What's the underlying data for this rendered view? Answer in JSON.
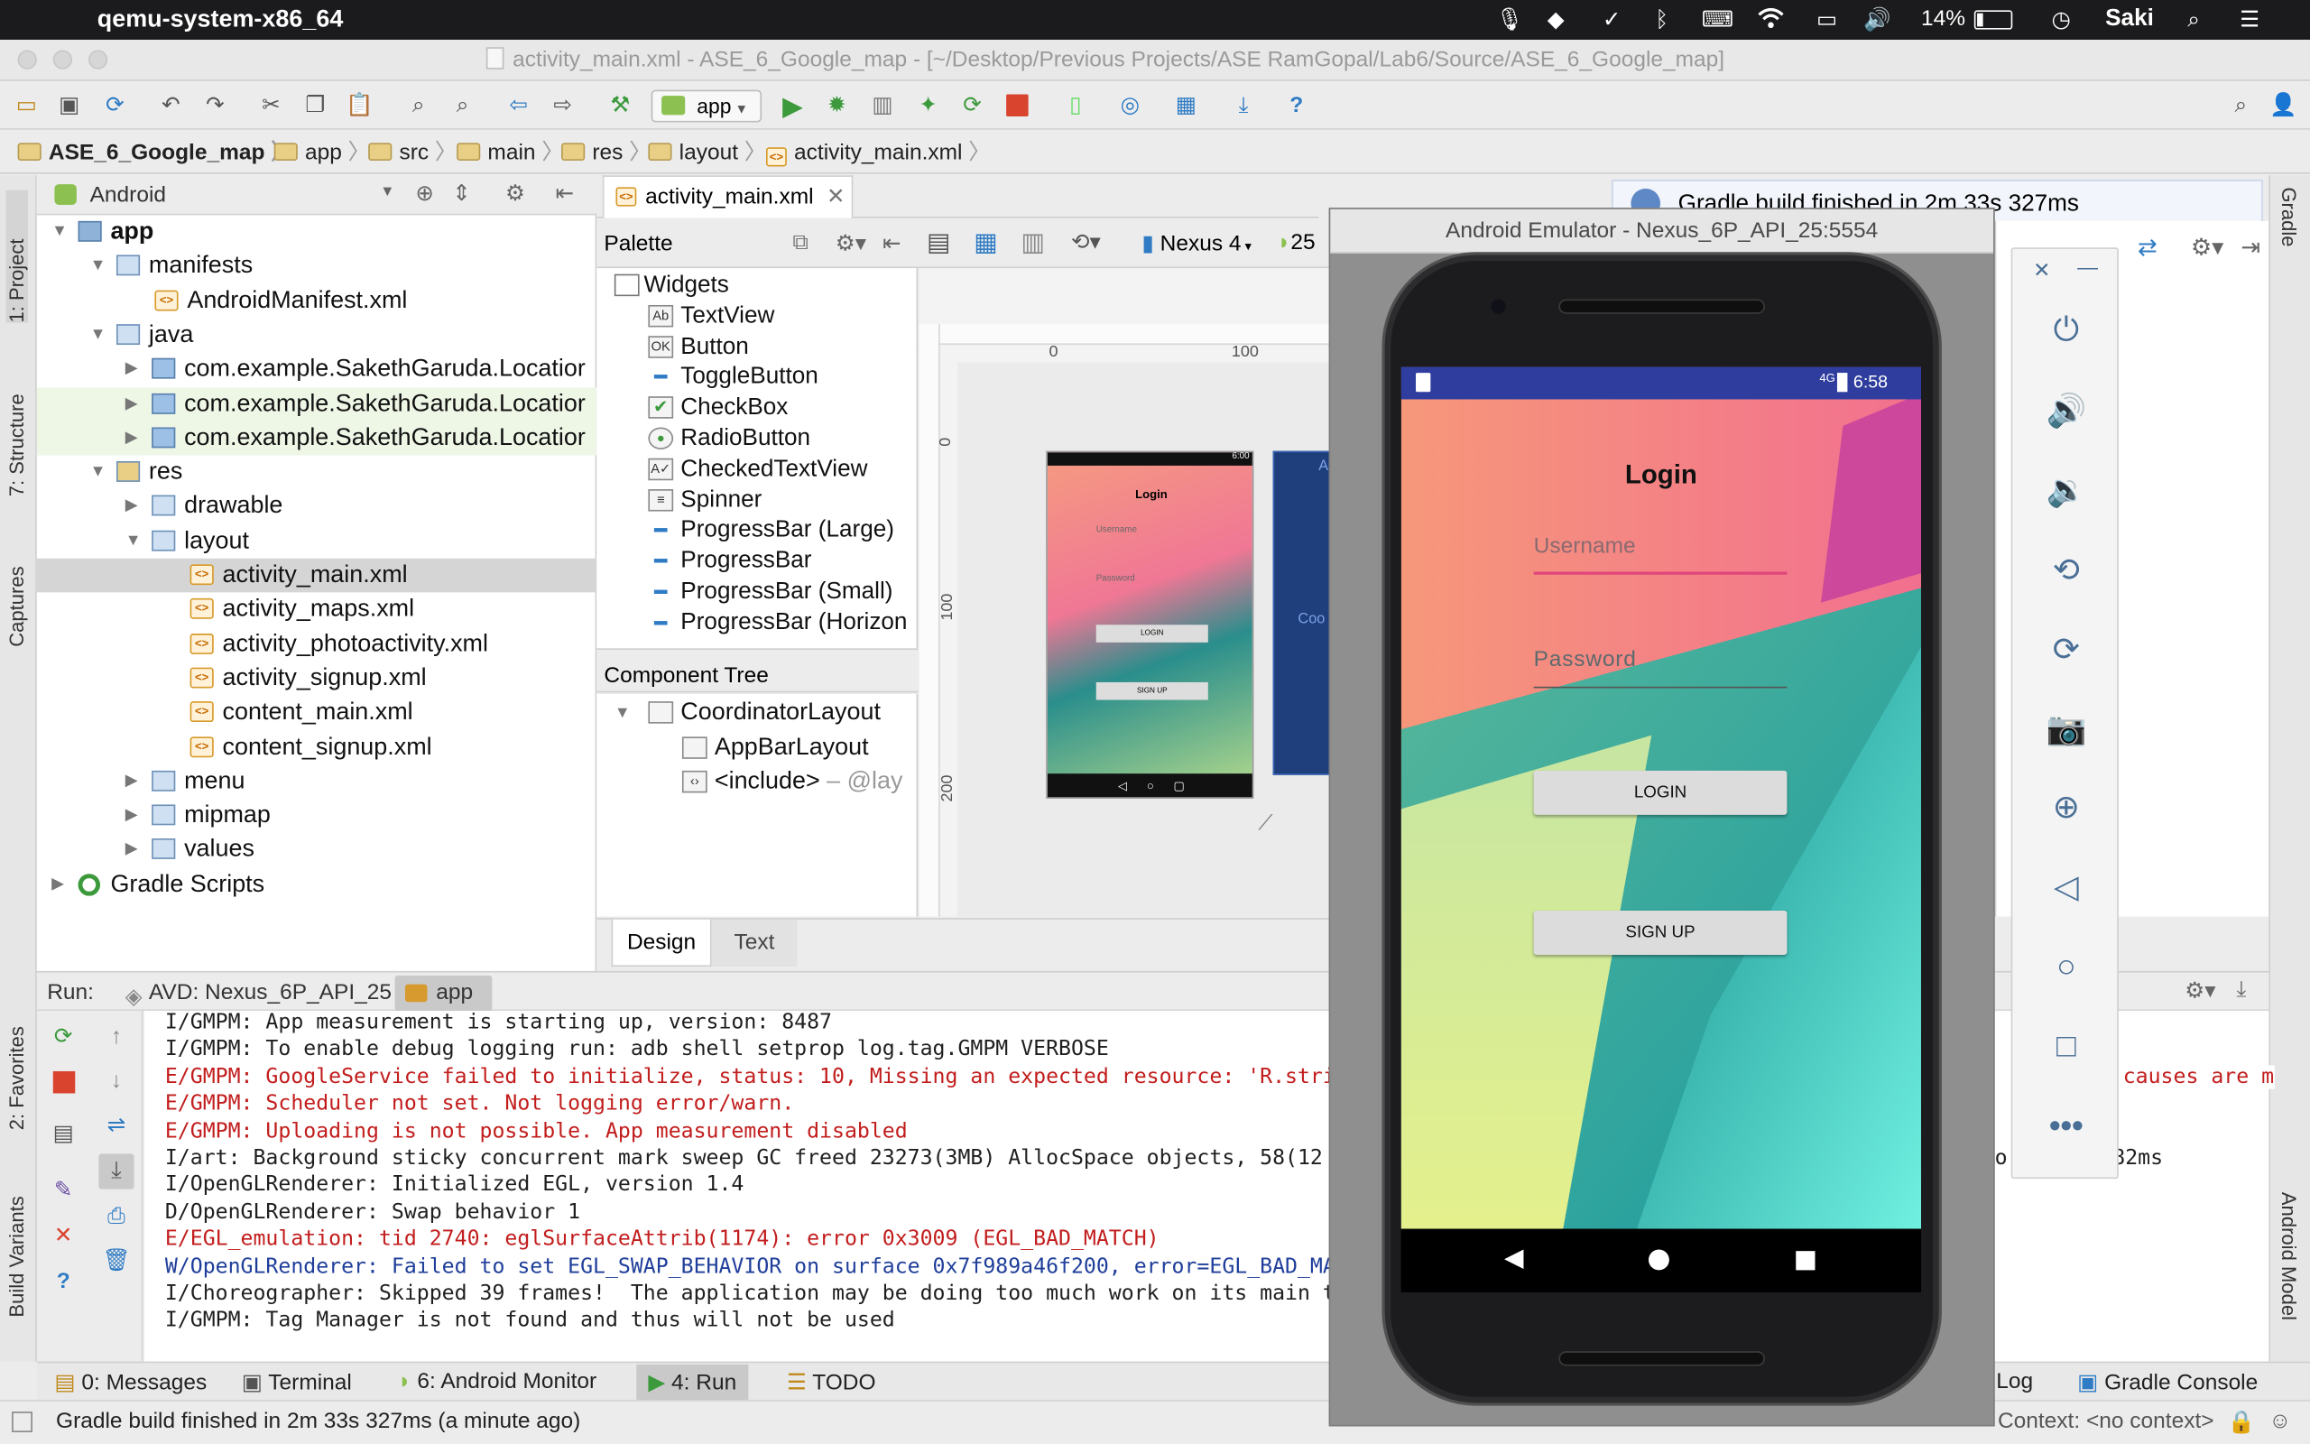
{
  "menubar": {
    "app_name": "qemu-system-x86_64",
    "battery": "14%",
    "user": "Saki",
    "icons": [
      "apple-icon",
      "mic-icon",
      "dropbox-icon",
      "checkmark-icon",
      "bluetooth-icon",
      "keyboard-icon",
      "wifi-icon",
      "airplay-icon",
      "volume-icon",
      "battery-icon",
      "clock-icon",
      "search-icon",
      "menu-icon"
    ]
  },
  "window": {
    "title": "activity_main.xml - ASE_6_Google_map - [~/Desktop/Previous Projects/ASE RamGopal/Lab6/Source/ASE_6_Google_map]"
  },
  "toolbar": {
    "run_config": "app"
  },
  "breadcrumbs": [
    "ASE_6_Google_map",
    "app",
    "src",
    "main",
    "res",
    "layout",
    "activity_main.xml"
  ],
  "left_stripe": [
    "1: Project",
    "7: Structure",
    "Captures",
    "2: Favorites",
    "Build Variants"
  ],
  "right_stripe": [
    "Gradle",
    "Android Model"
  ],
  "project": {
    "view_mode": "Android",
    "tree": [
      {
        "label": "app",
        "depth": 0,
        "type": "module",
        "expanded": true
      },
      {
        "label": "manifests",
        "depth": 1,
        "type": "folder",
        "expanded": true
      },
      {
        "label": "AndroidManifest.xml",
        "depth": 2,
        "type": "xml"
      },
      {
        "label": "java",
        "depth": 1,
        "type": "folder",
        "expanded": true
      },
      {
        "label": "com.example.SakethGaruda.Locatior",
        "depth": 2,
        "type": "package",
        "expanded": false
      },
      {
        "label": "com.example.SakethGaruda.Locatior",
        "depth": 2,
        "type": "package",
        "expanded": false
      },
      {
        "label": "com.example.SakethGaruda.Locatior",
        "depth": 2,
        "type": "package",
        "expanded": false
      },
      {
        "label": "res",
        "depth": 1,
        "type": "folder",
        "expanded": true
      },
      {
        "label": "drawable",
        "depth": 2,
        "type": "folder",
        "expanded": false
      },
      {
        "label": "layout",
        "depth": 2,
        "type": "folder",
        "expanded": true
      },
      {
        "label": "activity_main.xml",
        "depth": 3,
        "type": "xml",
        "selected": true
      },
      {
        "label": "activity_maps.xml",
        "depth": 3,
        "type": "xml"
      },
      {
        "label": "activity_photoactivity.xml",
        "depth": 3,
        "type": "xml"
      },
      {
        "label": "activity_signup.xml",
        "depth": 3,
        "type": "xml"
      },
      {
        "label": "content_main.xml",
        "depth": 3,
        "type": "xml"
      },
      {
        "label": "content_signup.xml",
        "depth": 3,
        "type": "xml"
      },
      {
        "label": "menu",
        "depth": 2,
        "type": "folder",
        "expanded": false
      },
      {
        "label": "mipmap",
        "depth": 2,
        "type": "folder",
        "expanded": false
      },
      {
        "label": "values",
        "depth": 2,
        "type": "folder",
        "expanded": false
      },
      {
        "label": "Gradle Scripts",
        "depth": 0,
        "type": "gradle",
        "expanded": false
      }
    ]
  },
  "editor": {
    "tab": "activity_main.xml",
    "device": "Nexus 4",
    "api": "25",
    "palette_title": "Palette",
    "palette": [
      {
        "label": "Widgets",
        "icon": "folder-icon",
        "glyph": ""
      },
      {
        "label": "TextView",
        "icon": "textview-icon",
        "glyph": "Ab"
      },
      {
        "label": "Button",
        "icon": "button-icon",
        "glyph": "OK"
      },
      {
        "label": "ToggleButton",
        "icon": "toggle-icon",
        "glyph": "▬"
      },
      {
        "label": "CheckBox",
        "icon": "checkbox-icon",
        "glyph": "✔"
      },
      {
        "label": "RadioButton",
        "icon": "radio-icon",
        "glyph": "●"
      },
      {
        "label": "CheckedTextView",
        "icon": "checkedtext-icon",
        "glyph": "A✓"
      },
      {
        "label": "Spinner",
        "icon": "spinner-icon",
        "glyph": "≡"
      },
      {
        "label": "ProgressBar (Large)",
        "icon": "progress-icon",
        "glyph": "▬"
      },
      {
        "label": "ProgressBar",
        "icon": "progress-icon",
        "glyph": "▬"
      },
      {
        "label": "ProgressBar (Small)",
        "icon": "progress-icon",
        "glyph": "▬"
      },
      {
        "label": "ProgressBar (Horizon",
        "icon": "progress-icon",
        "glyph": "▬"
      }
    ],
    "component_tree_title": "Component Tree",
    "component_tree": [
      {
        "label": "CoordinatorLayout",
        "suffix": ""
      },
      {
        "label": "AppBarLayout",
        "suffix": ""
      },
      {
        "label": "<include>",
        "suffix": " – @lay"
      }
    ],
    "ruler_marks": [
      "0",
      "100",
      "0",
      "100",
      "200"
    ],
    "preview": {
      "title": "Login",
      "username": "Username",
      "password": "Password",
      "login": "LOGIN",
      "signup": "SIGN UP",
      "time": "6:00"
    },
    "blueprint_labels": [
      "A",
      "Coo"
    ],
    "tabs": [
      "Design",
      "Text"
    ]
  },
  "notification": "Gradle build finished in 2m 33s 327ms",
  "run": {
    "label": "Run:",
    "tabs": [
      "AVD: Nexus_6P_API_25",
      "app"
    ],
    "lines": [
      {
        "level": "info",
        "text": "I/GMPM: App measurement is starting up, version: 8487"
      },
      {
        "level": "info",
        "text": "I/GMPM: To enable debug logging run: adb shell setprop log.tag.GMPM VERBOSE"
      },
      {
        "level": "err",
        "text": "E/GMPM: GoogleService failed to initialize, status: 10, Missing an expected resource: 'R.stri"
      },
      {
        "level": "err",
        "text": "E/GMPM: Scheduler not set. Not logging error/warn."
      },
      {
        "level": "err",
        "text": "E/GMPM: Uploading is not possible. App measurement disabled"
      },
      {
        "level": "info",
        "text": "I/art: Background sticky concurrent mark sweep GC freed 23273(3MB) AllocSpace objects, 58(12"
      },
      {
        "level": "info",
        "text": "I/OpenGLRenderer: Initialized EGL, version 1.4"
      },
      {
        "level": "info",
        "text": "D/OpenGLRenderer: Swap behavior 1"
      },
      {
        "level": "err",
        "text": "E/EGL_emulation: tid 2740: eglSurfaceAttrib(1174): error 0x3009 (EGL_BAD_MATCH)"
      },
      {
        "level": "warn",
        "text": "W/OpenGLRenderer: Failed to set EGL_SWAP_BEHAVIOR on surface 0x7f989a46f200, error=EGL_BAD_MA"
      },
      {
        "level": "info",
        "text": "I/Choreographer: Skipped 39 frames!  The application may be doing too much work on its main t"
      },
      {
        "level": "info",
        "text": "I/GMPM: Tag Manager is not found and thus will not be used"
      }
    ],
    "overflow_right_1": "causes are m",
    "overflow_right_2": "82ms",
    "overflow_right_3": "o"
  },
  "bottom_tabs": [
    "0: Messages",
    "Terminal",
    "6: Android Monitor",
    "4: Run",
    "TODO",
    "Log",
    "Gradle Console"
  ],
  "status": {
    "message": "Gradle build finished in 2m 33s 327ms (a minute ago)",
    "context": "Context: <no context>"
  },
  "emulator": {
    "title": "Android Emulator - Nexus_6P_API_25:5554",
    "time": "6:58",
    "signal": "4G",
    "app": {
      "title": "Login",
      "username_placeholder": "Username",
      "password_placeholder": "Password",
      "login_button": "LOGIN",
      "signup_button": "SIGN UP"
    },
    "controls": [
      "close-icon",
      "minimize-icon",
      "power-icon",
      "volume-up-icon",
      "volume-down-icon",
      "rotate-left-icon",
      "rotate-right-icon",
      "camera-icon",
      "zoom-icon",
      "back-icon",
      "home-icon",
      "overview-icon",
      "more-icon"
    ]
  }
}
